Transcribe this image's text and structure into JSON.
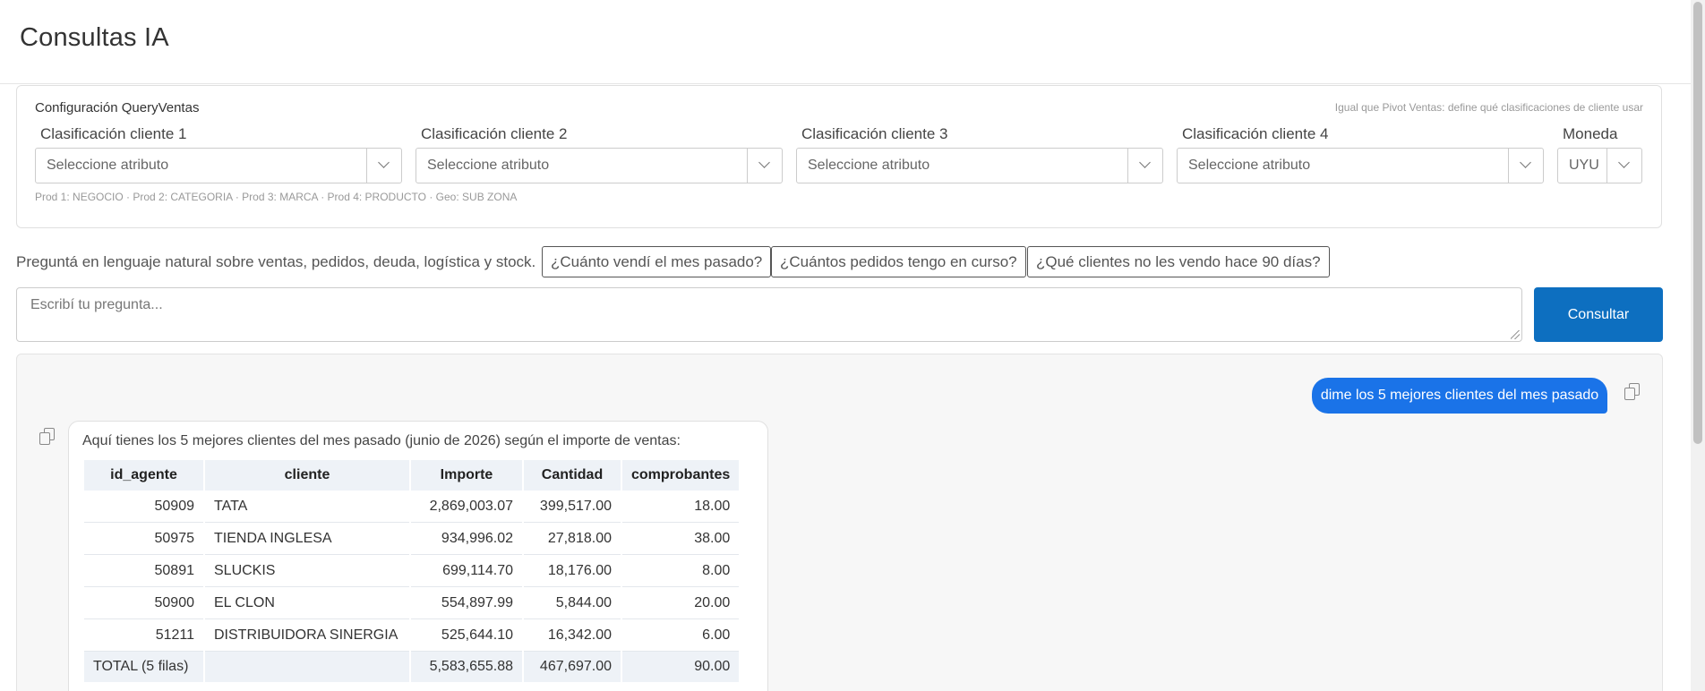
{
  "header": {
    "title": "Consultas IA"
  },
  "config": {
    "title": "Configuración QueryVentas",
    "hint": "Igual que Pivot Ventas: define qué clasificaciones de cliente usar",
    "fields": [
      {
        "label": "Clasificación cliente 1",
        "value": "Seleccione atributo"
      },
      {
        "label": "Clasificación cliente 2",
        "value": "Seleccione atributo"
      },
      {
        "label": "Clasificación cliente 3",
        "value": "Seleccione atributo"
      },
      {
        "label": "Clasificación cliente 4",
        "value": "Seleccione atributo"
      }
    ],
    "currency": {
      "label": "Moneda",
      "value": "UYU"
    },
    "footnote": "Prod 1: NEGOCIO · Prod 2: CATEGORIA · Prod 3: MARCA · Prod 4: PRODUCTO · Geo: SUB ZONA"
  },
  "ask": {
    "prompt": "Preguntá en lenguaje natural sobre ventas, pedidos, deuda, logística y stock.",
    "suggestions": [
      "¿Cuánto vendí el mes pasado?",
      "¿Cuántos pedidos tengo en curso?",
      "¿Qué clientes no les vendo hace 90 días?"
    ],
    "placeholder": "Escribí tu pregunta...",
    "submit_label": "Consultar"
  },
  "chat": {
    "user_message": "dime los 5 mejores clientes del mes pasado",
    "bot_intro": "Aquí tienes los 5 mejores clientes del mes pasado (junio de 2026) según el importe de ventas:",
    "table": {
      "columns": [
        "id_agente",
        "cliente",
        "Importe",
        "Cantidad",
        "comprobantes"
      ],
      "rows": [
        [
          "50909",
          "TATA",
          "2,869,003.07",
          "399,517.00",
          "18.00"
        ],
        [
          "50975",
          "TIENDA INGLESA",
          "934,996.02",
          "27,818.00",
          "38.00"
        ],
        [
          "50891",
          "SLUCKIS",
          "699,114.70",
          "18,176.00",
          "8.00"
        ],
        [
          "50900",
          "EL CLON",
          "554,897.99",
          "5,844.00",
          "20.00"
        ],
        [
          "51211",
          "DISTRIBUIDORA SINERGIA",
          "525,644.10",
          "16,342.00",
          "6.00"
        ]
      ],
      "total": [
        "TOTAL (5 filas)",
        "",
        "5,583,655.88",
        "467,697.00",
        "90.00"
      ]
    }
  },
  "icons": {
    "copy": "copy-icon",
    "dropdown": "chevron-down-icon",
    "resize": "resize-grip-icon"
  },
  "colors": {
    "primary_button": "#0d6fc0",
    "user_bubble": "#1a73e8",
    "table_header_bg": "#eef2f7"
  }
}
